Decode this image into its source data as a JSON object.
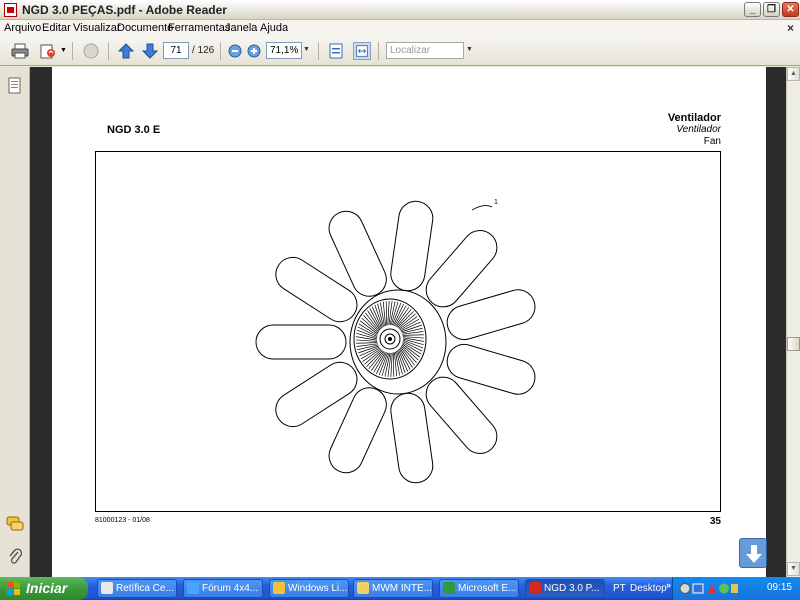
{
  "window": {
    "title": "NGD 3.0 PEÇAS.pdf - Adobe Reader",
    "minimize": "_",
    "maximize": "❐",
    "close": "✕"
  },
  "menu": {
    "items": [
      "Arquivo",
      "Editar",
      "Visualizar",
      "Documento",
      "Ferramentas",
      "Janela",
      "Ajuda"
    ],
    "doc_close": "×"
  },
  "toolbar": {
    "page_current": "71",
    "page_total": "/ 126",
    "zoom": "71,1%",
    "search_placeholder": "Localizar"
  },
  "document": {
    "model": "NGD 3.0 E",
    "section_pt": "Ventilador",
    "section_es": "Ventilador",
    "section_en": "Fan",
    "callout": "1",
    "footer_code": "81000123 - 01/08",
    "page_number": "35"
  },
  "taskbar": {
    "start_label": "Iniciar",
    "items": [
      {
        "label": "Retífica Ce...",
        "icon_color": "#e8e8e8"
      },
      {
        "label": "Fórum 4x4...",
        "icon_color": "#4aa3ff"
      },
      {
        "label": "Windows Li...",
        "icon_color": "#f2c23a"
      },
      {
        "label": "MWM INTE...",
        "icon_color": "#f0d060"
      },
      {
        "label": "Microsoft E...",
        "icon_color": "#2e9b3c"
      },
      {
        "label": "NGD 3.0 P...",
        "icon_color": "#d42a1f"
      }
    ],
    "language": "PT",
    "desktop_label": "Desktop",
    "chevron": "»",
    "clock": "09:15"
  },
  "colors": {
    "taskbar_blue": "#245edb",
    "start_green": "#3c9a3a",
    "reader_red": "#c00000"
  }
}
